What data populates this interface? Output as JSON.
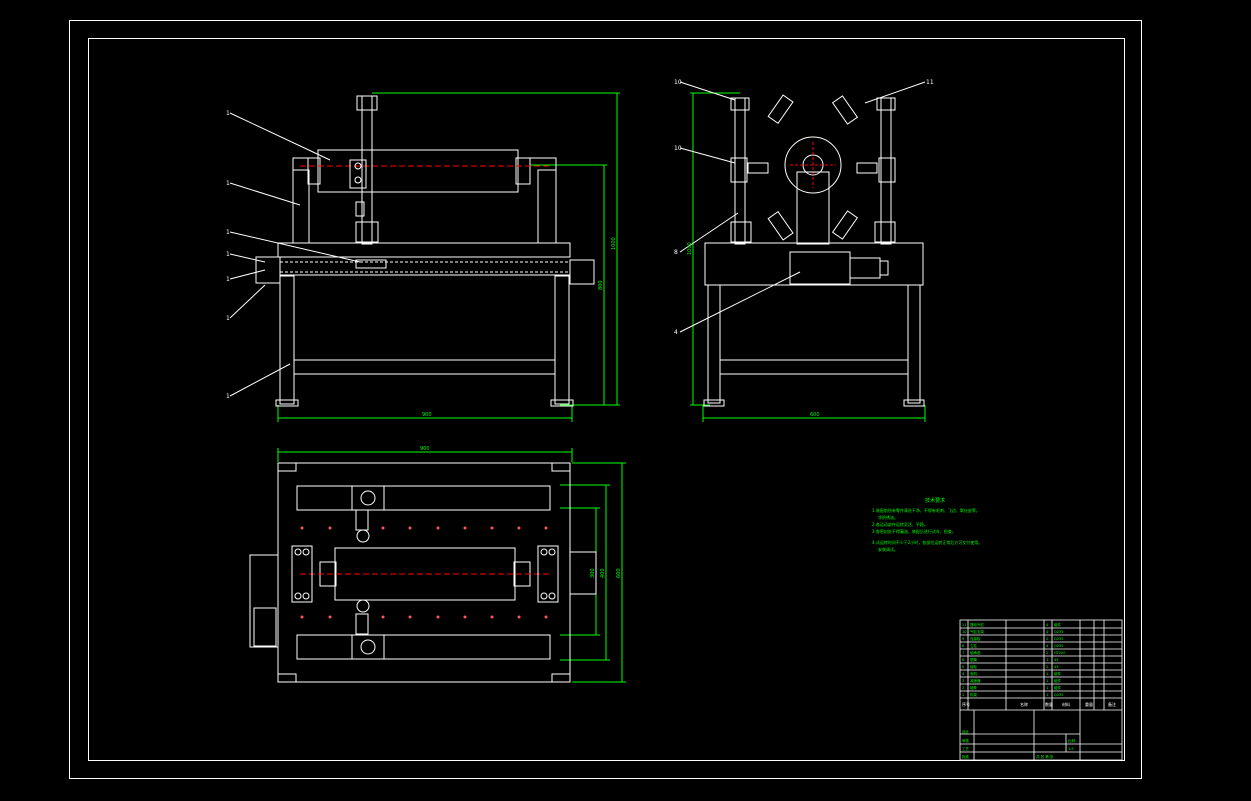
{
  "drawing": {
    "border_color": "#ffffff",
    "line_color": "#ffffff",
    "dimension_color": "#00ff00",
    "centerline_color": "#ff0000",
    "annotation_color": "#00ff00"
  },
  "front_view": {
    "callouts": [
      "1",
      "1",
      "1",
      "1",
      "1",
      "1",
      "1"
    ],
    "dim_width": "900",
    "dim_height_total": "1000",
    "dim_height_table": "800"
  },
  "side_view": {
    "callouts_left": [
      "10",
      "10",
      "8",
      "4"
    ],
    "callouts_right": [
      "11"
    ],
    "dim_width": "600",
    "dim_height": "1000"
  },
  "top_view": {
    "dim_length": "900",
    "dim_width_outer": "600",
    "dim_width_inner": "400",
    "dim_width_mid": "300"
  },
  "notes": {
    "title": "技术要求",
    "lines": [
      "1.装配前所有零件清洗干净，不得有毛刺、飞边、氧化皮等。",
      "涂防锈油。",
      "2.各运动部件运转灵活、平稳。",
      "3.各密封处不得漏油，装配后进行试车，检查。",
      "4.试运转时间不少于2小时，各部位运转正常后方可交付使用。",
      "安装调试。"
    ]
  },
  "title_block": {
    "parts_rows": [
      [
        "11",
        "摆动气缸",
        "4",
        "组件"
      ],
      [
        "10",
        "气缸支架",
        "4",
        "Q235"
      ],
      [
        "9",
        "连接板",
        "2",
        "Q235"
      ],
      [
        "8",
        "立柱",
        "4",
        "Q235"
      ],
      [
        "7",
        "轴承座",
        "2",
        "HT200"
      ],
      [
        "6",
        "辊筒",
        "1",
        "45"
      ],
      [
        "5",
        "链轮",
        "2",
        "45"
      ],
      [
        "4",
        "电机",
        "1",
        "组件"
      ],
      [
        "3",
        "减速器",
        "1",
        "组件"
      ],
      [
        "2",
        "链条",
        "1",
        "组件"
      ],
      [
        "1",
        "机架",
        "1",
        "Q235"
      ]
    ],
    "header": [
      "序号",
      "名称",
      "数量",
      "材料",
      "重量",
      "备注"
    ],
    "sign_rows": [
      "设计",
      "审核",
      "工艺",
      "批准"
    ],
    "scale_label": "比例",
    "scale_value": "1:5",
    "sheet_label": "共 张 第 张"
  }
}
